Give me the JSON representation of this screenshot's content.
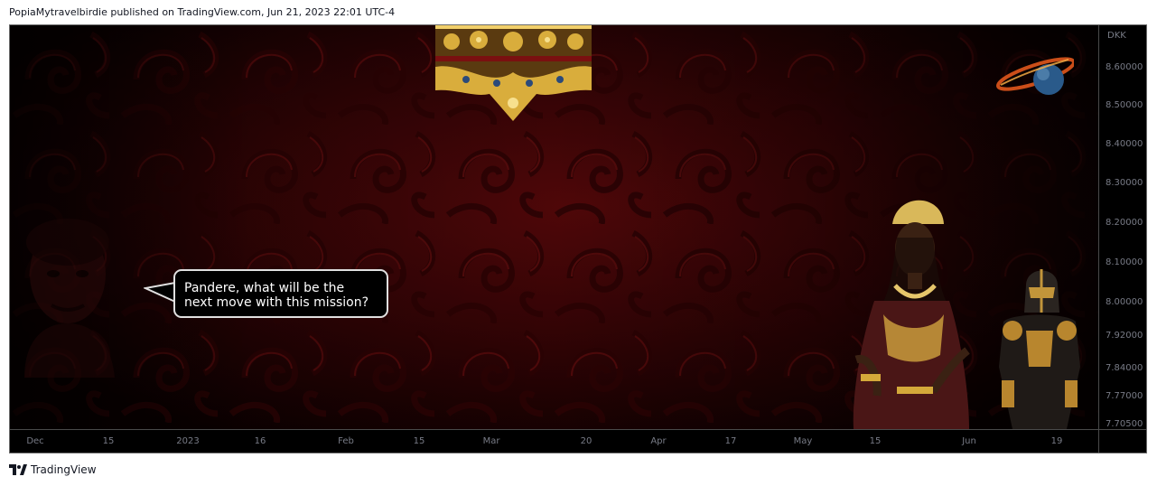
{
  "header": {
    "publish_line": "PopiaMytravelbirdie published on TradingView.com, Jun 21, 2023 22:01 UTC-4"
  },
  "chart": {
    "currency": "DKK",
    "price_ticks": [
      "8.60000",
      "8.50000",
      "8.40000",
      "8.30000",
      "8.20000",
      "8.10000",
      "8.00000",
      "7.92000",
      "7.84000",
      "7.77000",
      "7.70500"
    ],
    "time_ticks": [
      "Dec",
      "15",
      "2023",
      "16",
      "Feb",
      "15",
      "Mar",
      "20",
      "Apr",
      "17",
      "May",
      "15",
      "Jun",
      "19"
    ],
    "speech_bubble": {
      "line1": "Pandere, what will be the",
      "line2": "next move with this mission?"
    },
    "images": [
      "gold-ornament",
      "burning-planet",
      "ghost-face",
      "queen-figure",
      "armored-knight"
    ]
  },
  "footer": {
    "brand": "TradingView"
  },
  "colors": {
    "background": "#000000",
    "axis_text": "#787b86",
    "red_pattern": "#5a0a0c",
    "gold": "#d4a93a"
  }
}
